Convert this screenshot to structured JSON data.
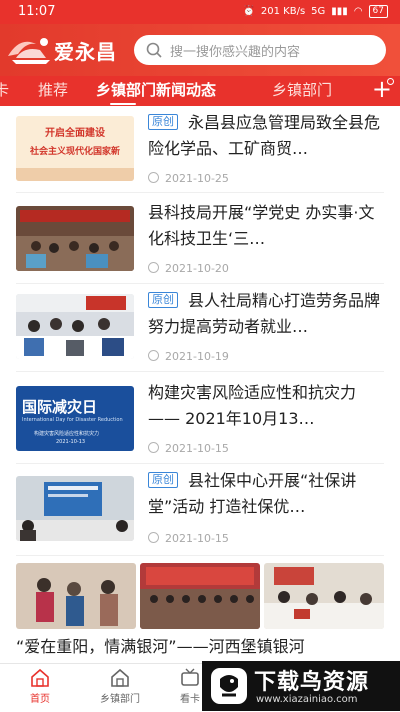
{
  "status_bar": {
    "time": "11:07",
    "net_speed": "201 KB/s",
    "signal": "5G",
    "battery": "67"
  },
  "app": {
    "logo_text": "爱永昌",
    "search_placeholder": "搜一搜你感兴趣的内容"
  },
  "tabs": [
    {
      "label": "卡"
    },
    {
      "label": "推荐"
    },
    {
      "label": "乡镇部门新闻动态",
      "active": true
    },
    {
      "label": "乡镇部门"
    }
  ],
  "news": [
    {
      "badge": "原创",
      "title": "永昌县应急管理局致全县危险化学品、工矿商贸…",
      "date": "2021-10-25",
      "thumb_text": "开启全面建设 / 社会主义现代化国家新"
    },
    {
      "badge": "",
      "title": "县科技局开展“学党史 办实事·文化科技卫生‘三…",
      "date": "2021-10-20",
      "thumb_text": ""
    },
    {
      "badge": "原创",
      "title": "县人社局精心打造劳务品牌 努力提高劳动者就业…",
      "date": "2021-10-19",
      "thumb_text": ""
    },
    {
      "badge": "",
      "title": "构建灾害风险适应性和抗灾力 —— 2021年10月13…",
      "date": "2021-10-15",
      "thumb_text": "国际减灾日",
      "thumb_sub": "International Day for Disaster Reduction",
      "thumb_sub2": "构建灾害风险适应性和抗灾力",
      "thumb_sub3": "2021-10-13"
    },
    {
      "badge": "原创",
      "title": "县社保中心开展“社保讲堂”活动 打造社保优…",
      "date": "2021-10-15",
      "thumb_text": ""
    }
  ],
  "big_item": {
    "title": "“爱在重阳，情满银河”——河西堡镇银河"
  },
  "bottom_nav": [
    {
      "label": "首页",
      "icon": "home-icon",
      "active": true
    },
    {
      "label": "乡镇部门",
      "icon": "building-icon"
    },
    {
      "label": "看卡",
      "icon": "tv-icon"
    }
  ],
  "watermark": {
    "title": "下载鸟资源",
    "url": "www.xiazainiao.com"
  },
  "colors": {
    "brand_red": "#e8322c",
    "badge_blue": "#3a86d8"
  }
}
